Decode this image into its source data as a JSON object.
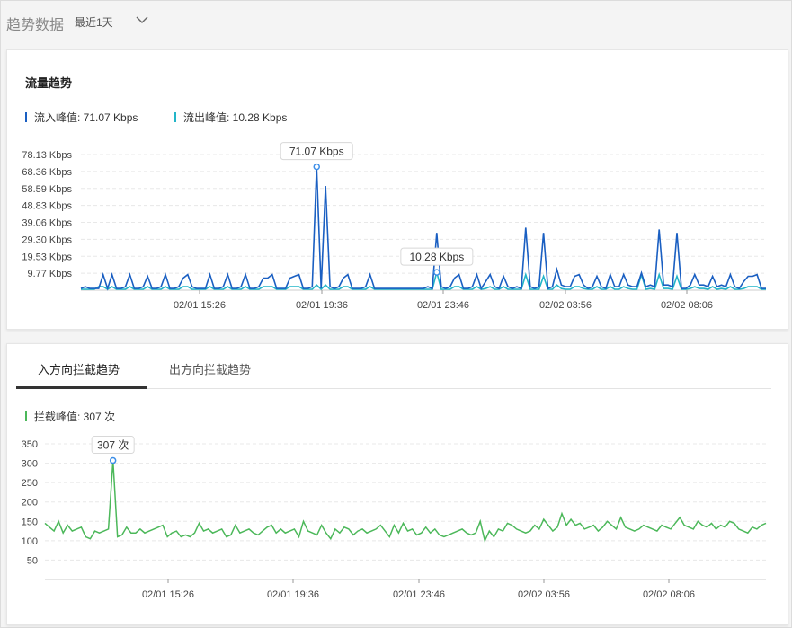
{
  "header": {
    "title": "趋势数据",
    "range": "最近1天"
  },
  "traffic": {
    "title": "流量趋势",
    "legend_in": "流入峰值: 71.07 Kbps",
    "legend_out": "流出峰值: 10.28 Kbps",
    "tooltip_in": "71.07 Kbps",
    "tooltip_out": "10.28 Kbps",
    "colors": {
      "inbound": "#1a5fc2",
      "outbound": "#22b5c8"
    }
  },
  "block": {
    "tab_in": "入方向拦截趋势",
    "tab_out": "出方向拦截趋势",
    "legend": "拦截峰值: 307 次",
    "tooltip": "307 次",
    "color": "#4cb85a"
  },
  "chart_data": [
    {
      "type": "line",
      "title": "流量趋势",
      "xlabel": "",
      "ylabel": "",
      "y_ticks": [
        "78.13 Kbps",
        "68.36 Kbps",
        "58.59 Kbps",
        "48.83 Kbps",
        "39.06 Kbps",
        "29.30 Kbps",
        "19.53 Kbps",
        "9.77 Kbps"
      ],
      "x_ticks": [
        "02/01 15:26",
        "02/01 19:36",
        "02/01 23:46",
        "02/02 03:56",
        "02/02 08:06"
      ],
      "ylim": [
        0,
        78.13
      ],
      "series": [
        {
          "name": "流入",
          "values": [
            1,
            2,
            1,
            1,
            1,
            9,
            1,
            9,
            1,
            1,
            2,
            9,
            1,
            1,
            2,
            8,
            1,
            1,
            2,
            9,
            1,
            1,
            2,
            7,
            9,
            2,
            1,
            1,
            1,
            9,
            1,
            1,
            2,
            9,
            1,
            1,
            2,
            9,
            1,
            1,
            2,
            7,
            7,
            9,
            1,
            1,
            1,
            7,
            8,
            9,
            1,
            1,
            2,
            71.07,
            1,
            60,
            2,
            1,
            2,
            7,
            9,
            1,
            1,
            1,
            2,
            9,
            1,
            1,
            1,
            1,
            1,
            1,
            1,
            1,
            1,
            1,
            1,
            1,
            2,
            1,
            33,
            2,
            1,
            2,
            7,
            9,
            1,
            1,
            2,
            9,
            1,
            5,
            9,
            2,
            1,
            8,
            2,
            1,
            2,
            1,
            36,
            2,
            1,
            2,
            33,
            1,
            2,
            12,
            3,
            2,
            2,
            8,
            9,
            3,
            1,
            2,
            8,
            2,
            1,
            9,
            2,
            2,
            9,
            3,
            2,
            2,
            10,
            2,
            3,
            2,
            35,
            3,
            3,
            2,
            33,
            1,
            1,
            3,
            9,
            3,
            3,
            2,
            8,
            2,
            3,
            2,
            9,
            2,
            1,
            5,
            8,
            8,
            9,
            1,
            1
          ],
          "peak": 71.07
        },
        {
          "name": "流出",
          "values": [
            0.5,
            0.5,
            0.5,
            0.5,
            2,
            2,
            0.5,
            2,
            0.5,
            0.5,
            0.5,
            2,
            0.5,
            0.5,
            0.5,
            2,
            0.5,
            0.5,
            0.5,
            2,
            0.5,
            0.5,
            0.5,
            2,
            2,
            0.5,
            0.5,
            0.5,
            0.5,
            2,
            0.5,
            0.5,
            0.5,
            2,
            0.5,
            0.5,
            0.5,
            2,
            0.5,
            0.5,
            0.5,
            2,
            2,
            2,
            0.5,
            0.5,
            0.5,
            2,
            2,
            2,
            0.5,
            0.5,
            0.5,
            3,
            0.5,
            3,
            0.5,
            0.5,
            0.5,
            2,
            2,
            0.5,
            0.5,
            0.5,
            0.5,
            2,
            0.5,
            0.5,
            0.5,
            0.5,
            0.5,
            0.5,
            0.5,
            0.5,
            0.5,
            0.5,
            0.5,
            0.5,
            0.5,
            0.5,
            10.28,
            0.5,
            0.5,
            0.5,
            2,
            2,
            0.5,
            0.5,
            0.5,
            2,
            0.5,
            1,
            2,
            0.5,
            0.5,
            2,
            0.5,
            0.5,
            0.5,
            0.5,
            9,
            0.5,
            0.5,
            0.5,
            8,
            0.5,
            0.5,
            3,
            1,
            0.5,
            0.5,
            2,
            2,
            1,
            0.5,
            0.5,
            2,
            0.5,
            0.5,
            2,
            0.5,
            0.5,
            2,
            1,
            0.5,
            0.5,
            9,
            0.5,
            1,
            0.5,
            9,
            1,
            1,
            0.5,
            8,
            0.5,
            0.5,
            1,
            2,
            1,
            1,
            0.5,
            2,
            0.5,
            1,
            0.5,
            2,
            0.5,
            0.5,
            1,
            2,
            2,
            2,
            0.5,
            0.5
          ],
          "peak": 10.28
        }
      ]
    },
    {
      "type": "line",
      "title": "",
      "xlabel": "",
      "ylabel": "",
      "y_ticks": [
        350,
        300,
        250,
        200,
        150,
        100,
        50
      ],
      "x_ticks": [
        "02/01 15:26",
        "02/01 19:36",
        "02/01 23:46",
        "02/02 03:56",
        "02/02 08:06"
      ],
      "ylim": [
        0,
        375
      ],
      "series": [
        {
          "name": "拦截",
          "values": [
            145,
            135,
            125,
            150,
            120,
            140,
            125,
            130,
            135,
            110,
            105,
            125,
            120,
            125,
            130,
            307,
            110,
            115,
            135,
            120,
            120,
            130,
            120,
            125,
            130,
            135,
            140,
            110,
            120,
            125,
            110,
            115,
            110,
            120,
            145,
            125,
            130,
            120,
            125,
            130,
            110,
            115,
            140,
            120,
            125,
            130,
            120,
            115,
            125,
            135,
            140,
            120,
            130,
            120,
            125,
            130,
            110,
            150,
            125,
            120,
            115,
            140,
            120,
            105,
            130,
            120,
            135,
            130,
            115,
            125,
            130,
            120,
            125,
            130,
            140,
            125,
            110,
            140,
            120,
            145,
            125,
            130,
            115,
            120,
            135,
            120,
            130,
            115,
            110,
            115,
            120,
            125,
            130,
            120,
            115,
            120,
            150,
            100,
            125,
            110,
            130,
            125,
            145,
            140,
            130,
            125,
            120,
            125,
            140,
            130,
            155,
            140,
            125,
            135,
            170,
            140,
            155,
            140,
            145,
            130,
            135,
            140,
            125,
            135,
            150,
            140,
            130,
            160,
            135,
            130,
            125,
            130,
            140,
            135,
            130,
            125,
            140,
            135,
            130,
            145,
            160,
            140,
            135,
            130,
            150,
            140,
            135,
            145,
            130,
            140,
            135,
            150,
            145,
            130,
            125,
            120,
            135,
            130,
            140,
            145
          ],
          "peak": 307
        }
      ]
    }
  ]
}
